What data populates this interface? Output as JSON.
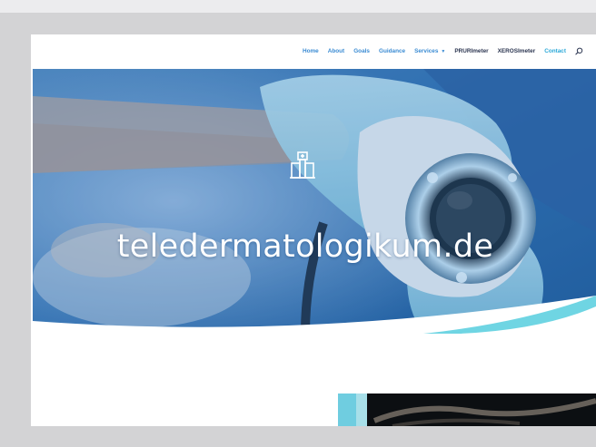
{
  "nav": {
    "items": [
      {
        "label": "Home"
      },
      {
        "label": "About"
      },
      {
        "label": "Goals"
      },
      {
        "label": "Guidance"
      },
      {
        "label": "Services"
      },
      {
        "label": "PRURImeter"
      },
      {
        "label": "XEROSImeter"
      },
      {
        "label": "Contact"
      }
    ],
    "search_icon": "search-icon"
  },
  "hero": {
    "title": "teledermatologikum.de",
    "logo_icon": "hospital-building-icon"
  },
  "colors": {
    "nav_link": "#3a8bd3",
    "nav_link_dark": "#2b3550",
    "hero_blue": "#2a6fae",
    "accent_cyan": "#5fd0e0",
    "frame_gray": "#d3d3d5"
  }
}
